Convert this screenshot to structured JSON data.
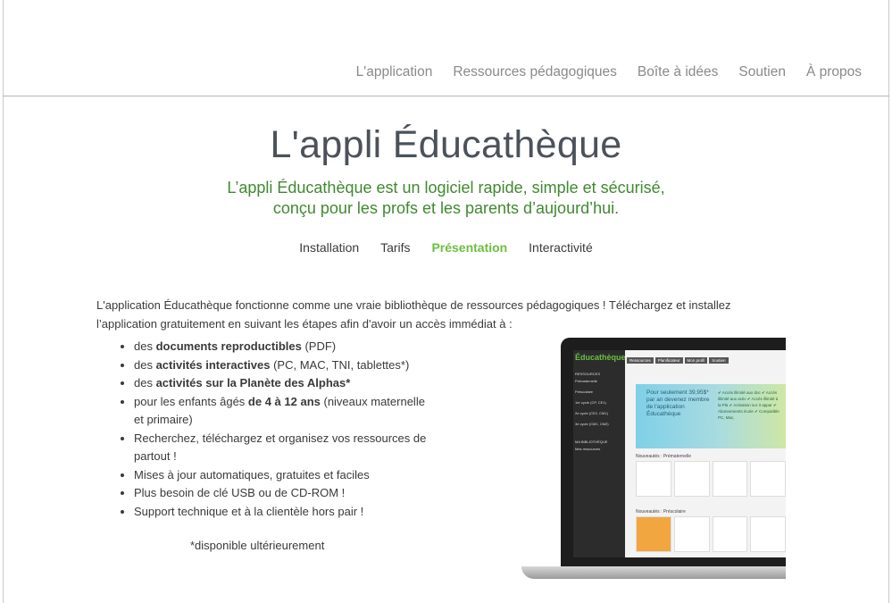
{
  "topnav": {
    "items": [
      "L'application",
      "Ressources pédagogiques",
      "Boîte à idées",
      "Soutien",
      "À propos"
    ]
  },
  "page": {
    "title": "L'appli Éducathèque",
    "subtitle_line1": "L’appli Éducathèque est un logiciel rapide, simple et sécurisé,",
    "subtitle_line2": "conçu pour les profs et les parents d’aujourd’hui."
  },
  "subnav": {
    "items": [
      "Installation",
      "Tarifs",
      "Présentation",
      "Interactivité"
    ],
    "active": "Présentation"
  },
  "intro": "L'application Éducathèque fonctionne comme une vraie bibliothèque de ressources pédagogiques ! Téléchargez et installez l’application gratuitement en suivant les étapes afin d'avoir un accès immédiat à :",
  "features": [
    {
      "pre": "des ",
      "bold": "documents reproductibles",
      "post": " (PDF)"
    },
    {
      "pre": "des ",
      "bold": "activités interactives",
      "post": " (PC, MAC, TNI, tablettes*)"
    },
    {
      "pre": "des ",
      "bold": "activités sur la Planète des Alphas*",
      "post": ""
    },
    {
      "pre": "pour les enfants âgés ",
      "bold": "de 4 à 12 ans",
      "post": " (niveaux maternelle et primaire)"
    },
    {
      "pre": "Recherchez, téléchargez et organisez vos ressources de partout !",
      "bold": "",
      "post": ""
    },
    {
      "pre": "Mises à jour automatiques, gratuites et faciles",
      "bold": "",
      "post": ""
    },
    {
      "pre": "Plus besoin de clé USB ou de CD-ROM !",
      "bold": "",
      "post": ""
    },
    {
      "pre": "Support technique et à la clientèle hors pair !",
      "bold": "",
      "post": ""
    }
  ],
  "note": "*disponible ultérieurement",
  "mockup": {
    "logo": "ducathèque",
    "tabs": [
      "Ressources",
      "Planificateur",
      "Mon profil",
      "Soutien"
    ],
    "sidebar": [
      "RESSOURCES",
      "Prématernelle",
      "Préscolaire",
      "1er cycle (CP, CE1)",
      "2e cycle (CE2, CM1)",
      "3e cycle (CM1, CM2)",
      "MA BIBLIOTHÈQUE",
      "Mes ressources"
    ],
    "banner_text": "Pour seulement 39,95$* par an devenez membre de l'application Éducathèque",
    "banner_list": "✔ Accès illimité aux doc ✔ Accès illimité aux activ ✔ Accès illimité à la Pla ✔ Activation sur 3 appar ✔ Abonnements école ✔ Compatible PC, Mac,",
    "section1": "Nouveautés : Prématernelle",
    "section2": "Nouveautés : Préscolaire"
  },
  "colors": {
    "accent_green": "#6cbf3f",
    "subtitle_green": "#3f8a2f",
    "nav_gray": "#8a8a8a"
  }
}
